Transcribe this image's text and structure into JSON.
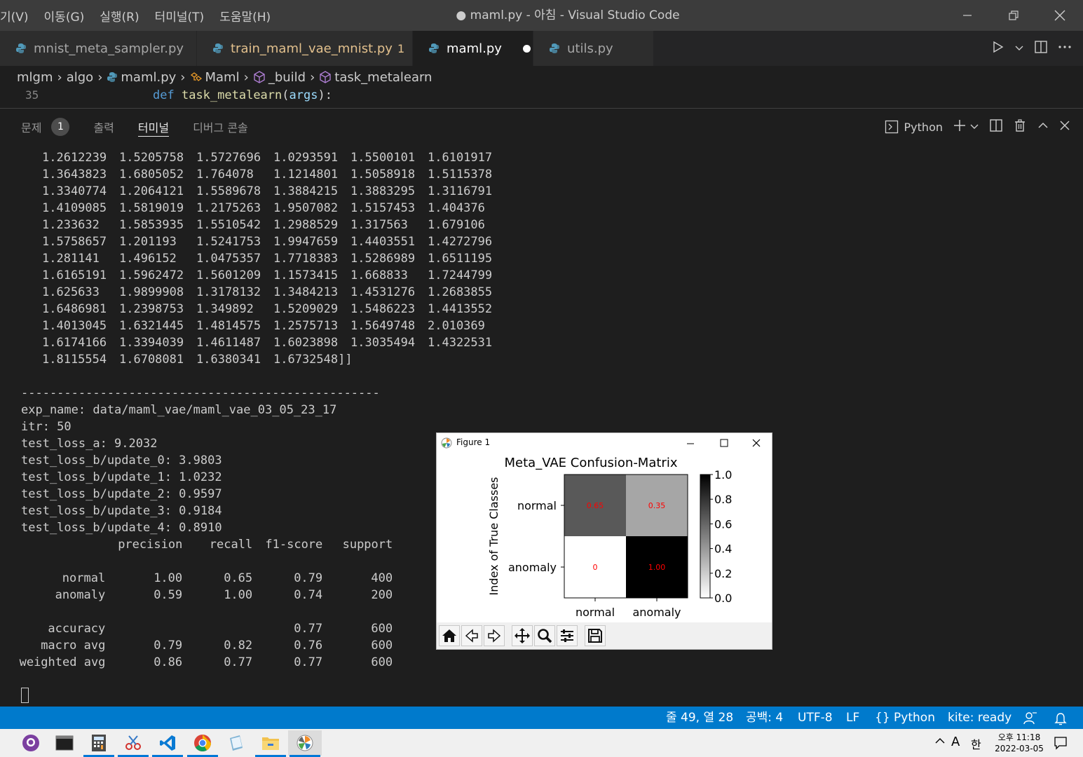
{
  "titlebar": {
    "menu": [
      "기(V)",
      "이동(G)",
      "실행(R)",
      "터미널(T)",
      "도움말(H)"
    ],
    "window_title": "● maml.py - 아침 - Visual Studio Code"
  },
  "tabs": [
    {
      "label": "mnist_meta_sampler.py"
    },
    {
      "label": "train_maml_vae_mnist.py",
      "problems": "1"
    },
    {
      "label": "maml.py"
    },
    {
      "label": "utils.py"
    }
  ],
  "breadcrumb": [
    "mlgm",
    "algo",
    "maml.py",
    "Maml",
    "_build",
    "task_metalearn"
  ],
  "editor": {
    "line_number": "35",
    "code": {
      "kw": "def",
      "fn": "task_metalearn",
      "open": "(",
      "arg": "args",
      "close": "):"
    }
  },
  "panel": {
    "tabs": [
      "문제",
      "출력",
      "터미널",
      "디버그 콘솔"
    ],
    "problem_count": "1",
    "active_tab": "터미널",
    "terminal_kind": "Python"
  },
  "terminal": {
    "matrix_rows": [
      [
        "1.2612239",
        "1.5205758",
        "1.5727696",
        "1.0293591",
        "1.5500101",
        "1.6101917"
      ],
      [
        "1.3643823",
        "1.6805052",
        "1.764078",
        "1.1214801",
        "1.5058918",
        "1.5115378"
      ],
      [
        "1.3340774",
        "1.2064121",
        "1.5589678",
        "1.3884215",
        "1.3883295",
        "1.3116791"
      ],
      [
        "1.4109085",
        "1.5819019",
        "1.2175263",
        "1.9507082",
        "1.5157453",
        "1.404376"
      ],
      [
        "1.233632",
        "1.5853935",
        "1.5510542",
        "1.2988529",
        "1.317563",
        "1.679106"
      ],
      [
        "1.5758657",
        "1.201193",
        "1.5241753",
        "1.9947659",
        "1.4403551",
        "1.4272796"
      ],
      [
        "1.281141",
        "1.496152",
        "1.0475357",
        "1.7718383",
        "1.5286989",
        "1.6511195"
      ],
      [
        "1.6165191",
        "1.5962472",
        "1.5601209",
        "1.1573415",
        "1.668833",
        "1.7244799"
      ],
      [
        "1.625633",
        "1.9899908",
        "1.3178132",
        "1.3484213",
        "1.4531276",
        "1.2683855"
      ],
      [
        "1.6486981",
        "1.2398753",
        "1.349892",
        "1.5209029",
        "1.5486223",
        "1.4413552"
      ],
      [
        "1.4013045",
        "1.6321445",
        "1.4814575",
        "1.2575713",
        "1.5649748",
        "2.010369"
      ],
      [
        "1.6174166",
        "1.3394039",
        "1.4611487",
        "1.6023898",
        "1.3035494",
        "1.4322531"
      ],
      [
        "1.8115554",
        "1.6708081",
        "1.6380341",
        "1.6732548]]"
      ]
    ],
    "divider": "--------------------------------------------------",
    "log_lines": [
      "exp_name: data/maml_vae/maml_vae_03_05_23_17",
      "itr: 50",
      "test_loss_a: 9.2032",
      "test_loss_b/update_0: 3.9803",
      "test_loss_b/update_1: 1.0232",
      "test_loss_b/update_2: 0.9597",
      "test_loss_b/update_3: 0.9184",
      "test_loss_b/update_4: 0.8910"
    ],
    "report": {
      "header": [
        "precision",
        "recall",
        "f1-score",
        "support"
      ],
      "rows": [
        {
          "label": "normal",
          "values": [
            "1.00",
            "0.65",
            "0.79",
            "400"
          ]
        },
        {
          "label": "anomaly",
          "values": [
            "0.59",
            "1.00",
            "0.74",
            "200"
          ]
        }
      ],
      "accuracy": {
        "label": "accuracy",
        "values": [
          "",
          "",
          "0.77",
          "600"
        ]
      },
      "macro": {
        "label": "macro avg",
        "values": [
          "0.79",
          "0.82",
          "0.76",
          "600"
        ]
      },
      "weighted": {
        "label": "weighted avg",
        "values": [
          "0.86",
          "0.77",
          "0.77",
          "600"
        ]
      }
    }
  },
  "figure": {
    "window_title": "Figure 1",
    "chart_data": {
      "type": "heatmap",
      "title": "Meta_VAE Confusion-Matrix",
      "ylabel": "Index of True Classes",
      "xlabel": "",
      "x_categories": [
        "normal",
        "anomaly"
      ],
      "y_categories": [
        "normal",
        "anomaly"
      ],
      "values": [
        [
          0.65,
          0.35
        ],
        [
          0,
          1.0
        ]
      ],
      "cell_labels": [
        [
          "0.65",
          "0.35"
        ],
        [
          "0",
          "1.00"
        ]
      ],
      "colorbar_ticks": [
        "1.0",
        "0.8",
        "0.6",
        "0.4",
        "0.2",
        "0.0"
      ],
      "colorbar_range": [
        0,
        1
      ],
      "colormap": "gray_r",
      "label_color": "#ff0000"
    }
  },
  "statusbar": {
    "position": "줄 49, 열 28",
    "spaces": "공백: 4",
    "encoding": "UTF-8",
    "eol": "LF",
    "language": "Python",
    "kite": "kite: ready"
  },
  "taskbar": {
    "time": "오후 11:18",
    "date": "2022-03-05",
    "ime_lang": "A",
    "ime_mode": "한"
  },
  "colors": {
    "statusbar": "#007acc",
    "titlebar": "#3c3c3c",
    "editor_bg": "#1e1e1e",
    "modified": "#e2c08d"
  }
}
